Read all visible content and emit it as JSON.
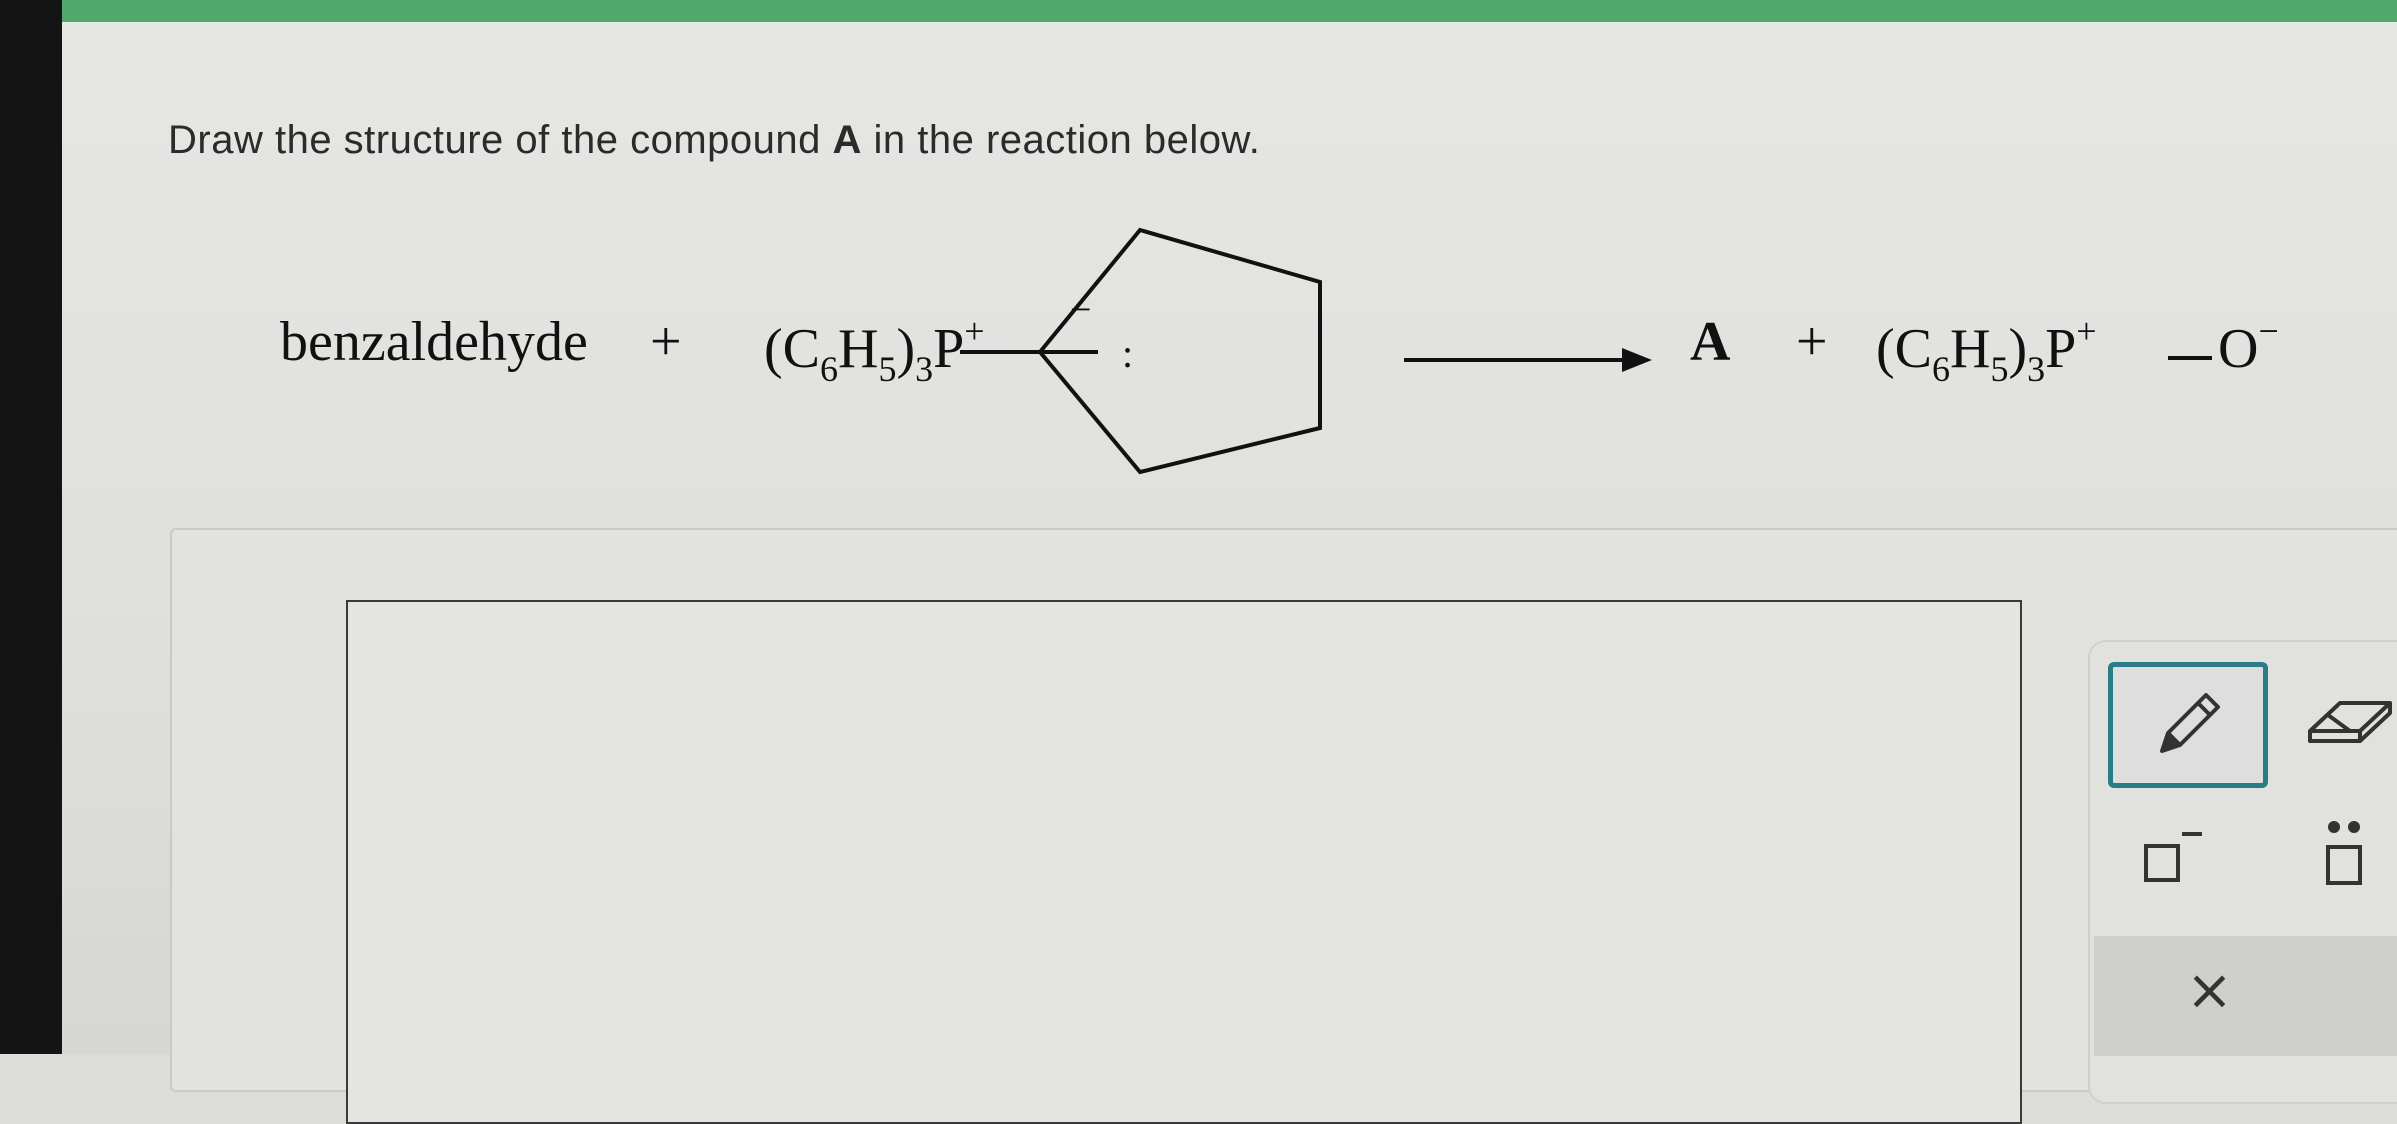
{
  "question": {
    "prefix": "Draw the structure of the compound ",
    "bold": "A",
    "suffix": " in the reaction below."
  },
  "reaction": {
    "reactant1": "benzaldehyde",
    "plus1": "+",
    "ylide_prefix": "(C",
    "ylide_sub1": "6",
    "ylide_h": "H",
    "ylide_sub2": "5",
    "ylide_paren": ")",
    "ylide_sub3": "3",
    "ylide_p": "P",
    "ylide_charge": "+",
    "carbanion_charge": "−",
    "lone_pair": ":",
    "product": "A",
    "plus2": "+",
    "oxide_prefix": "(C",
    "oxide_sub1": "6",
    "oxide_h": "H",
    "oxide_sub2": "5",
    "oxide_paren": ")",
    "oxide_sub3": "3",
    "oxide_p": "P",
    "oxide_charge": "+",
    "oxide_o": "O",
    "oxide_o_charge": "−"
  },
  "toolbar": {
    "tools": [
      "pencil-icon",
      "eraser-icon",
      "negative-charge-icon",
      "lone-pair-icon"
    ],
    "clear_label": "×",
    "accent": "#2a7d87"
  }
}
